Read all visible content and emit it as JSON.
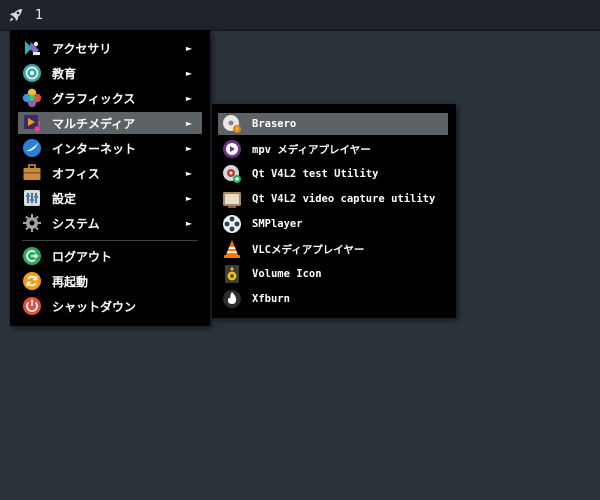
{
  "taskbar": {
    "workspace": "1",
    "launcher_icon": "rocket-icon"
  },
  "main_menu": {
    "items": [
      {
        "label": "アクセサリ",
        "icon": "accessories-icon",
        "has_submenu": true
      },
      {
        "label": "教育",
        "icon": "education-icon",
        "has_submenu": true
      },
      {
        "label": "グラフィックス",
        "icon": "graphics-icon",
        "has_submenu": true
      },
      {
        "label": "マルチメディア",
        "icon": "multimedia-icon",
        "has_submenu": true,
        "selected": true
      },
      {
        "label": "インターネット",
        "icon": "internet-icon",
        "has_submenu": true
      },
      {
        "label": "オフィス",
        "icon": "office-icon",
        "has_submenu": true
      },
      {
        "label": "設定",
        "icon": "settings-icon",
        "has_submenu": true
      },
      {
        "label": "システム",
        "icon": "system-icon",
        "has_submenu": true
      }
    ],
    "session": [
      {
        "label": "ログアウト",
        "icon": "logout-icon"
      },
      {
        "label": "再起動",
        "icon": "restart-icon"
      },
      {
        "label": "シャットダウン",
        "icon": "shutdown-icon"
      }
    ],
    "arrow": "►"
  },
  "sub_menu": {
    "items": [
      {
        "label": "Brasero",
        "icon": "brasero-icon",
        "selected": true
      },
      {
        "label": "mpv メディアプレイヤー",
        "icon": "mpv-icon"
      },
      {
        "label": "Qt V4L2 test Utility",
        "icon": "qv4l2-icon"
      },
      {
        "label": "Qt V4L2 video capture utility",
        "icon": "qvidcap-icon"
      },
      {
        "label": "SMPlayer",
        "icon": "smplayer-icon"
      },
      {
        "label": "VLCメディアプレイヤー",
        "icon": "vlc-icon"
      },
      {
        "label": "Volume Icon",
        "icon": "volume-icon"
      },
      {
        "label": "Xfburn",
        "icon": "xfburn-icon"
      }
    ]
  },
  "colors": {
    "desktop": "#2b333b",
    "menu_bg": "#000000",
    "selection": "#5c6266"
  }
}
